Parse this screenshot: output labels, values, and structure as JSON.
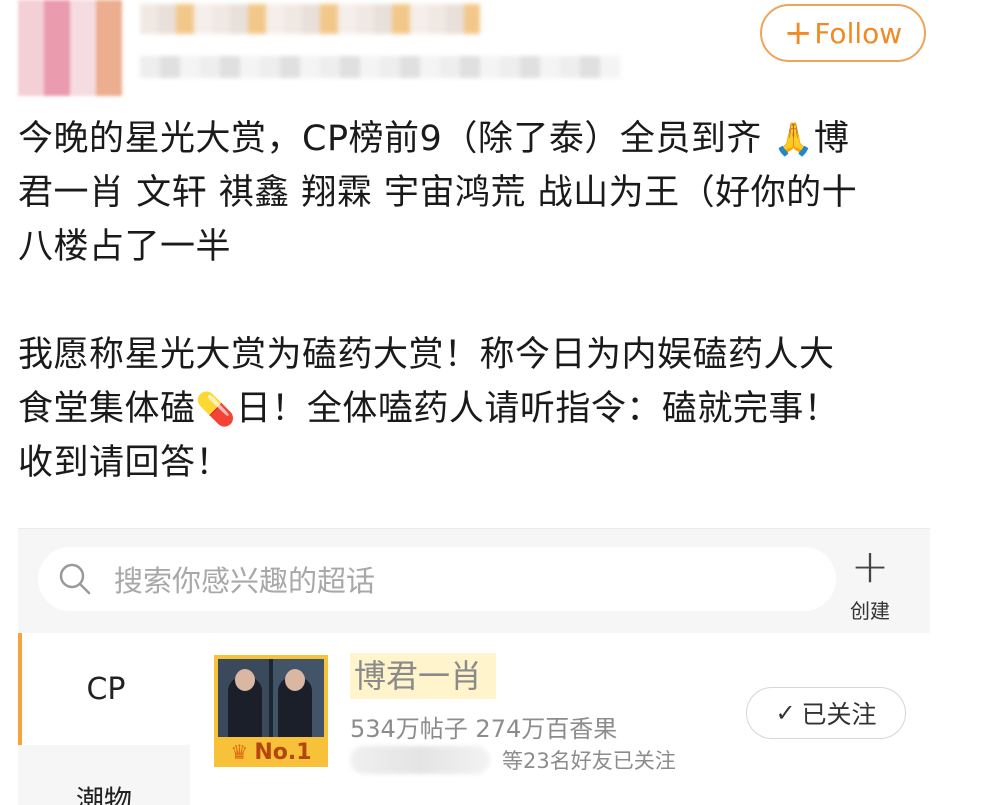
{
  "header": {
    "follow_label": "Follow"
  },
  "post": {
    "para1_line1": "今晚的星光大赏，CP榜前9（除了泰）全员到齐",
    "para1_line1_tail": "博",
    "para1_line2": "君一肖 文轩 祺鑫 翔霖 宇宙鸿荒 战山为王（好你的十",
    "para1_line3": "八楼占了一半",
    "para2_line1": "我愿称星光大赏为磕药大赏！称今日为内娱磕药人大",
    "para2_line2_head": "食堂集体磕",
    "para2_line2_tail": "日！全体嗑药人请听指令：磕就完事！",
    "para2_line3": "收到请回答！",
    "emoji_praying": "🙏",
    "emoji_pill": "💊"
  },
  "supertopic": {
    "search_placeholder": "搜索你感兴趣的超话",
    "create_label": "创建",
    "categories": [
      {
        "label": "CP"
      },
      {
        "label": "潮物"
      }
    ],
    "item": {
      "title": "博君一肖",
      "stats": "534万帖子 274万百香果",
      "friends_text": "等23名好友已关注",
      "rank_label": "No.1",
      "followed_label": "已关注"
    }
  },
  "colors": {
    "accent": "#f08a24",
    "rank_bg": "#f7c23a",
    "title_highlight": "#fff4cc"
  }
}
